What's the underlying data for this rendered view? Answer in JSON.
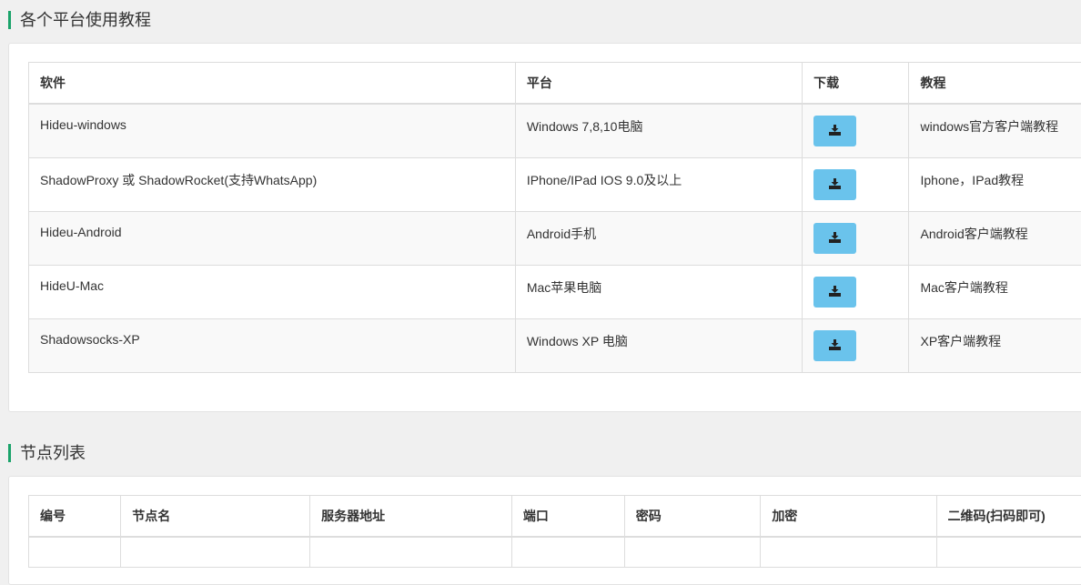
{
  "tutorials_section": {
    "title": "各个平台使用教程",
    "headers": [
      "软件",
      "平台",
      "下载",
      "教程"
    ],
    "rows": [
      {
        "software": "Hideu-windows",
        "platform": "Windows 7,8,10电脑",
        "tutorial": "windows官方客户端教程"
      },
      {
        "software": "ShadowProxy 或 ShadowRocket(支持WhatsApp)",
        "platform": "IPhone/IPad IOS 9.0及以上",
        "tutorial": "Iphone，IPad教程"
      },
      {
        "software": "Hideu-Android",
        "platform": "Android手机",
        "tutorial": "Android客户端教程"
      },
      {
        "software": "HideU-Mac",
        "platform": "Mac苹果电脑",
        "tutorial": "Mac客户端教程"
      },
      {
        "software": "Shadowsocks-XP",
        "platform": "Windows XP 电脑",
        "tutorial": "XP客户端教程"
      }
    ],
    "download_icon": "download-icon",
    "download_button_color": "#6ac3ec"
  },
  "nodes_section": {
    "title": "节点列表",
    "headers": [
      "编号",
      "节点名",
      "服务器地址",
      "端口",
      "密码",
      "加密",
      "二维码(扫码即可)"
    ]
  },
  "accent_color": "#1aa36a"
}
